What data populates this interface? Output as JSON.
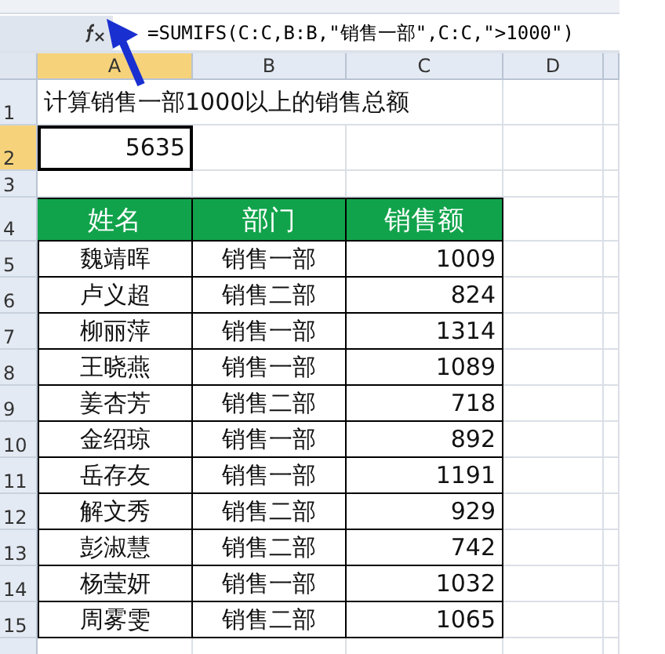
{
  "formula_bar": {
    "formula": "=SUMIFS(C:C,B:B,\"销售一部\",C:C,\">1000\")"
  },
  "columns": [
    {
      "label": "A",
      "selected": true
    },
    {
      "label": "B",
      "selected": false
    },
    {
      "label": "C",
      "selected": false
    },
    {
      "label": "D",
      "selected": false
    }
  ],
  "title_row": {
    "number": "1",
    "text": "计算销售一部1000以上的销售总额"
  },
  "result_row": {
    "number": "2",
    "value": "5635",
    "selected": true
  },
  "blank_row": {
    "number": "3"
  },
  "table": {
    "number": "4",
    "columns": [
      "姓名",
      "部门",
      "销售额"
    ],
    "rows": [
      {
        "number": "5",
        "cells": [
          "魏靖晖",
          "销售一部",
          "1009"
        ]
      },
      {
        "number": "6",
        "cells": [
          "卢义超",
          "销售二部",
          "824"
        ]
      },
      {
        "number": "7",
        "cells": [
          "柳丽萍",
          "销售一部",
          "1314"
        ]
      },
      {
        "number": "8",
        "cells": [
          "王晓燕",
          "销售一部",
          "1089"
        ]
      },
      {
        "number": "9",
        "cells": [
          "姜杏芳",
          "销售二部",
          "718"
        ]
      },
      {
        "number": "10",
        "cells": [
          "金绍琼",
          "销售一部",
          "892"
        ]
      },
      {
        "number": "11",
        "cells": [
          "岳存友",
          "销售一部",
          "1191"
        ]
      },
      {
        "number": "12",
        "cells": [
          "解文秀",
          "销售二部",
          "929"
        ]
      },
      {
        "number": "13",
        "cells": [
          "彭淑慧",
          "销售二部",
          "742"
        ]
      },
      {
        "number": "14",
        "cells": [
          "杨莹妍",
          "销售一部",
          "1032"
        ]
      },
      {
        "number": "15",
        "cells": [
          "周雾雯",
          "销售二部",
          "1065"
        ]
      }
    ]
  }
}
